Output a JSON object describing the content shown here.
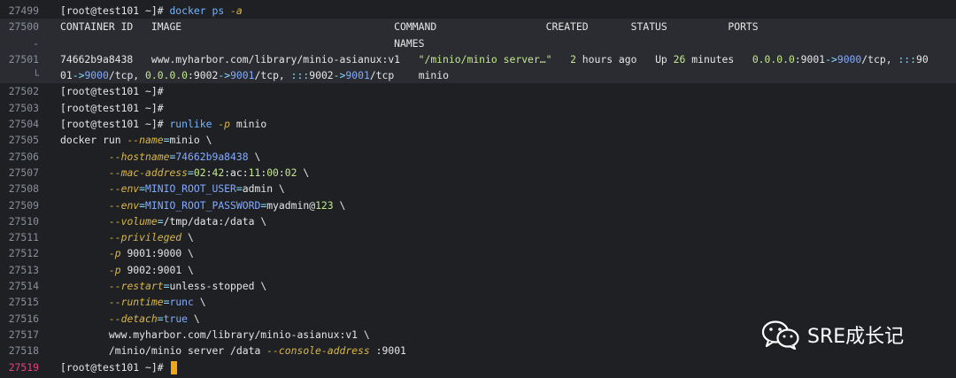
{
  "lines": [
    {
      "no": "27499",
      "segments": [
        [
          "pr",
          "[root@test101 ~]# "
        ],
        [
          "cmd",
          "docker ps "
        ],
        [
          "flag",
          "-a"
        ]
      ]
    },
    {
      "no": "27500",
      "hl": true,
      "segments": [
        [
          "hdr",
          "CONTAINER ID   IMAGE                                   COMMAND                  CREATED       STATUS          PORTS"
        ]
      ]
    },
    {
      "no": "-",
      "hl": true,
      "segments": [
        [
          "hdr",
          "                                                       NAMES"
        ]
      ]
    },
    {
      "no": "27501",
      "hl": true,
      "segments": [
        [
          "hdr",
          "74662b9a8438   www.myharbor.com/library/minio-asianux:v1   "
        ],
        [
          "str",
          "\"/minio/minio server…\""
        ],
        [
          "hdr",
          "   "
        ],
        [
          "num",
          "2"
        ],
        [
          "hdr",
          " hours ago   Up "
        ],
        [
          "num",
          "26"
        ],
        [
          "hdr",
          " minutes   "
        ],
        [
          "num",
          "0.0.0.0"
        ],
        [
          "hdr",
          ":9001"
        ],
        [
          "eq",
          "->"
        ],
        [
          "val",
          "9000"
        ],
        [
          "hdr",
          "/tcp, "
        ],
        [
          "eq",
          ":::"
        ],
        [
          "hdr",
          "90"
        ]
      ]
    },
    {
      "no": "└",
      "hl": true,
      "segments": [
        [
          "hdr",
          "01"
        ],
        [
          "eq",
          "->"
        ],
        [
          "val",
          "9000"
        ],
        [
          "hdr",
          "/tcp, "
        ],
        [
          "num",
          "0.0.0.0"
        ],
        [
          "hdr",
          ":9002"
        ],
        [
          "eq",
          "->"
        ],
        [
          "val",
          "9001"
        ],
        [
          "hdr",
          "/tcp, "
        ],
        [
          "eq",
          ":::"
        ],
        [
          "hdr",
          "9002"
        ],
        [
          "eq",
          "->"
        ],
        [
          "val",
          "9001"
        ],
        [
          "hdr",
          "/tcp    minio"
        ]
      ]
    },
    {
      "no": "27502",
      "segments": [
        [
          "pr",
          "[root@test101 ~]#"
        ]
      ]
    },
    {
      "no": "27503",
      "segments": [
        [
          "pr",
          "[root@test101 ~]#"
        ]
      ]
    },
    {
      "no": "27504",
      "segments": [
        [
          "pr",
          "[root@test101 ~]# "
        ],
        [
          "cmd",
          "runlike "
        ],
        [
          "flag",
          "-p"
        ],
        [
          "pr",
          " minio"
        ]
      ]
    },
    {
      "no": "27505",
      "segments": [
        [
          "pr",
          "docker run "
        ],
        [
          "flag",
          "--name"
        ],
        [
          "eq",
          "="
        ],
        [
          "pr",
          "minio \\"
        ]
      ]
    },
    {
      "no": "27506",
      "segments": [
        [
          "pr",
          "        "
        ],
        [
          "flag",
          "--hostname"
        ],
        [
          "eq",
          "="
        ],
        [
          "val",
          "74662b9a8438"
        ],
        [
          "pr",
          " \\"
        ]
      ]
    },
    {
      "no": "27507",
      "segments": [
        [
          "pr",
          "        "
        ],
        [
          "flag",
          "--mac-address"
        ],
        [
          "eq",
          "="
        ],
        [
          "num",
          "02"
        ],
        [
          "pr",
          ":"
        ],
        [
          "num",
          "42"
        ],
        [
          "pr",
          ":ac:"
        ],
        [
          "num",
          "11"
        ],
        [
          "pr",
          ":"
        ],
        [
          "num",
          "00"
        ],
        [
          "pr",
          ":"
        ],
        [
          "num",
          "02"
        ],
        [
          "pr",
          " \\"
        ]
      ]
    },
    {
      "no": "27508",
      "segments": [
        [
          "pr",
          "        "
        ],
        [
          "flag",
          "--env"
        ],
        [
          "eq",
          "="
        ],
        [
          "val",
          "MINIO_ROOT_USER"
        ],
        [
          "eq",
          "="
        ],
        [
          "pr",
          "admin \\"
        ]
      ]
    },
    {
      "no": "27509",
      "segments": [
        [
          "pr",
          "        "
        ],
        [
          "flag",
          "--env"
        ],
        [
          "eq",
          "="
        ],
        [
          "val",
          "MINIO_ROOT_PASSWORD"
        ],
        [
          "eq",
          "="
        ],
        [
          "pr",
          "myadmin@"
        ],
        [
          "num",
          "123"
        ],
        [
          "pr",
          " \\"
        ]
      ]
    },
    {
      "no": "27510",
      "segments": [
        [
          "pr",
          "        "
        ],
        [
          "flag",
          "--volume"
        ],
        [
          "eq",
          "="
        ],
        [
          "pr",
          "/tmp/data:/data \\"
        ]
      ]
    },
    {
      "no": "27511",
      "segments": [
        [
          "pr",
          "        "
        ],
        [
          "flag",
          "--privileged"
        ],
        [
          "pr",
          " \\"
        ]
      ]
    },
    {
      "no": "27512",
      "segments": [
        [
          "pr",
          "        "
        ],
        [
          "flag",
          "-p"
        ],
        [
          "pr",
          " 9001:9000 \\"
        ]
      ]
    },
    {
      "no": "27513",
      "segments": [
        [
          "pr",
          "        "
        ],
        [
          "flag",
          "-p"
        ],
        [
          "pr",
          " 9002:9001 \\"
        ]
      ]
    },
    {
      "no": "27514",
      "segments": [
        [
          "pr",
          "        "
        ],
        [
          "flag",
          "--restart"
        ],
        [
          "eq",
          "="
        ],
        [
          "pr",
          "unless-stopped \\"
        ]
      ]
    },
    {
      "no": "27515",
      "segments": [
        [
          "pr",
          "        "
        ],
        [
          "flag",
          "--runtime"
        ],
        [
          "eq",
          "="
        ],
        [
          "val",
          "runc"
        ],
        [
          "pr",
          " \\"
        ]
      ]
    },
    {
      "no": "27516",
      "segments": [
        [
          "pr",
          "        "
        ],
        [
          "flag",
          "--detach"
        ],
        [
          "eq",
          "="
        ],
        [
          "val",
          "true"
        ],
        [
          "pr",
          " \\"
        ]
      ]
    },
    {
      "no": "27517",
      "segments": [
        [
          "pr",
          "        www.myharbor.com/library/minio-asianux:v1 \\"
        ]
      ]
    },
    {
      "no": "27518",
      "segments": [
        [
          "pr",
          "        /minio/minio server /data "
        ],
        [
          "flag",
          "--console-address"
        ],
        [
          "pr",
          " :9001"
        ]
      ]
    },
    {
      "no": "27519",
      "cur": true,
      "segments": [
        [
          "pr",
          "[root@test101 ~]# "
        ]
      ]
    }
  ],
  "watermark": {
    "text": "SRE成长记",
    "icon": "wechat-icon"
  },
  "colors": {
    "bg": "#1e2024",
    "cursor": "#f2a516",
    "linenum_active": "#e0457b"
  }
}
